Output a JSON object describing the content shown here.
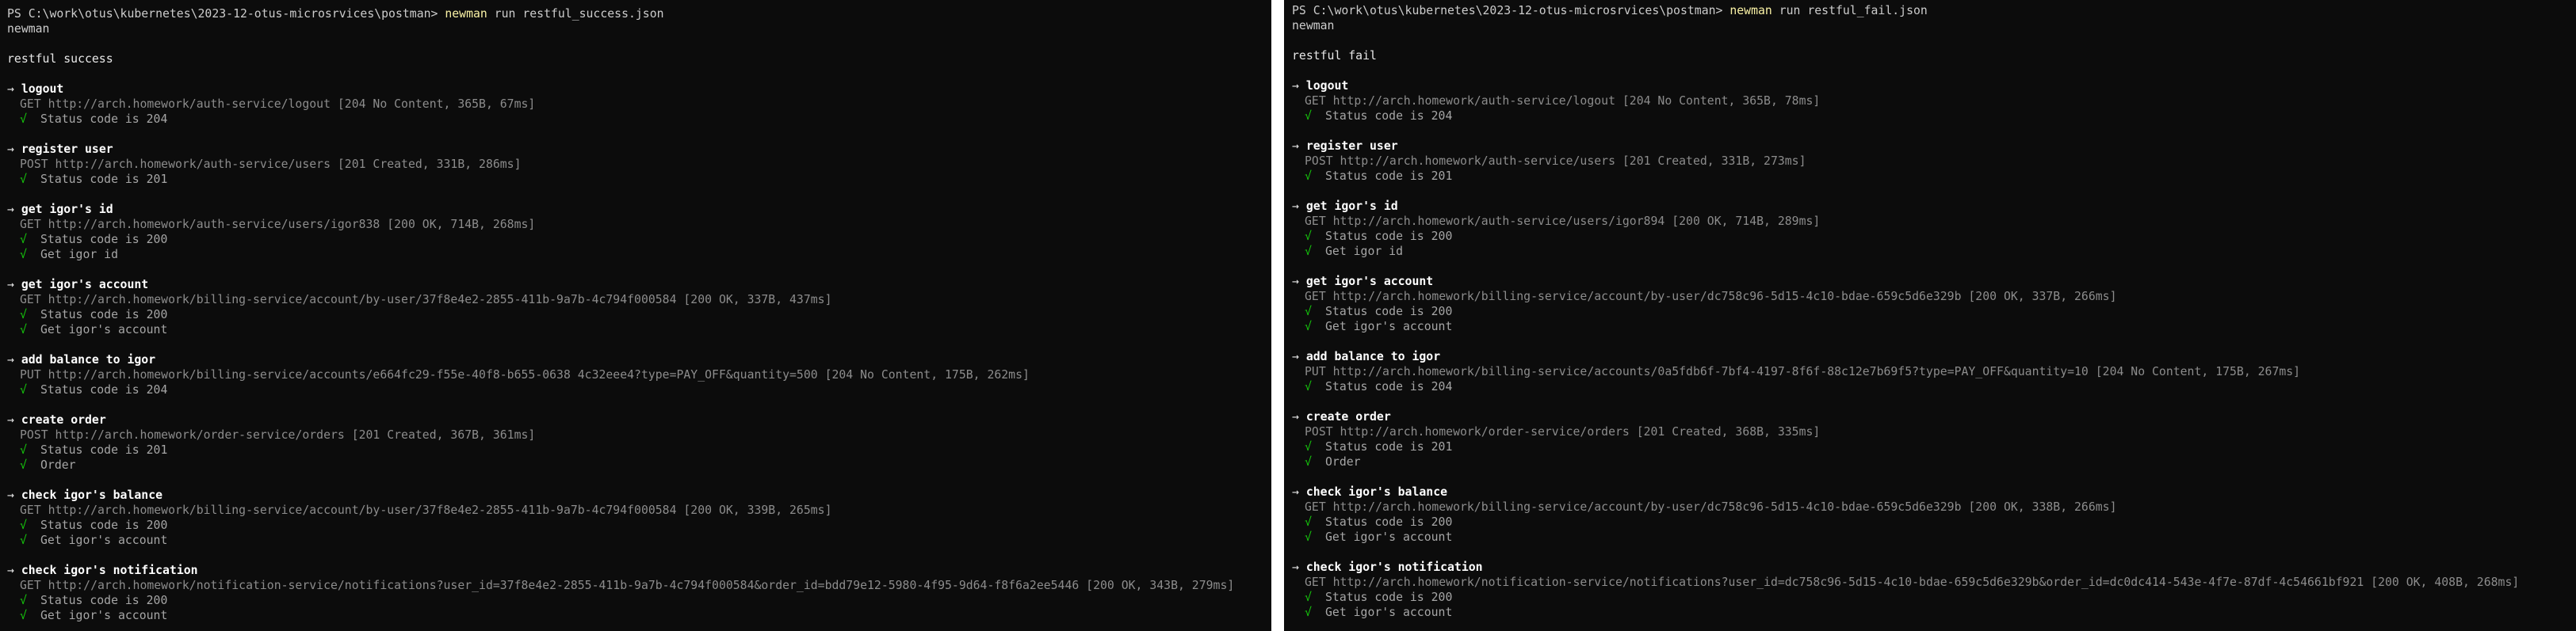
{
  "panes": [
    {
      "prompt": "PS C:\\work\\otus\\kubernetes\\2023-12-otus-microsrvices\\postman>",
      "command": "newman",
      "args": "run restful_success.json",
      "tool_line": "newman",
      "collection": "restful success",
      "requests": [
        {
          "name": "logout",
          "request": "GET http://arch.homework/auth-service/logout [204 No Content, 365B, 67ms]",
          "assertions": [
            "Status code is 204"
          ]
        },
        {
          "name": "register user",
          "request": "POST http://arch.homework/auth-service/users [201 Created, 331B, 286ms]",
          "assertions": [
            "Status code is 201"
          ]
        },
        {
          "name": "get igor's id",
          "request": "GET http://arch.homework/auth-service/users/igor838 [200 OK, 714B, 268ms]",
          "assertions": [
            "Status code is 200",
            "Get igor id"
          ]
        },
        {
          "name": "get igor's account",
          "request": "GET http://arch.homework/billing-service/account/by-user/37f8e4e2-2855-411b-9a7b-4c794f000584 [200 OK, 337B, 437ms]",
          "assertions": [
            "Status code is 200",
            "Get igor's account"
          ]
        },
        {
          "name": "add balance to igor",
          "request": "PUT http://arch.homework/billing-service/accounts/e664fc29-f55e-40f8-b655-0638 4c32eee4?type=PAY_OFF&quantity=500 [204 No Content, 175B, 262ms]",
          "assertions": [
            "Status code is 204"
          ]
        },
        {
          "name": "create order",
          "request": "POST http://arch.homework/order-service/orders [201 Created, 367B, 361ms]",
          "assertions": [
            "Status code is 201",
            "Order"
          ]
        },
        {
          "name": "check igor's balance",
          "request": "GET http://arch.homework/billing-service/account/by-user/37f8e4e2-2855-411b-9a7b-4c794f000584 [200 OK, 339B, 265ms]",
          "assertions": [
            "Status code is 200",
            "Get igor's account"
          ]
        },
        {
          "name": "check igor's notification",
          "request": "GET http://arch.homework/notification-service/notifications?user_id=37f8e4e2-2855-411b-9a7b-4c794f000584&order_id=bdd79e12-5980-4f95-9d64-f8f6a2ee5446 [200 OK, 343B, 279ms]",
          "assertions": [
            "Status code is 200",
            "Get igor's account"
          ]
        }
      ]
    },
    {
      "prompt": "PS C:\\work\\otus\\kubernetes\\2023-12-otus-microsrvices\\postman>",
      "command": "newman",
      "args": "run restful_fail.json",
      "tool_line": "newman",
      "collection": "restful fail",
      "requests": [
        {
          "name": "logout",
          "request": "GET http://arch.homework/auth-service/logout [204 No Content, 365B, 78ms]",
          "assertions": [
            "Status code is 204"
          ]
        },
        {
          "name": "register user",
          "request": "POST http://arch.homework/auth-service/users [201 Created, 331B, 273ms]",
          "assertions": [
            "Status code is 201"
          ]
        },
        {
          "name": "get igor's id",
          "request": "GET http://arch.homework/auth-service/users/igor894 [200 OK, 714B, 289ms]",
          "assertions": [
            "Status code is 200",
            "Get igor id"
          ]
        },
        {
          "name": "get igor's account",
          "request": "GET http://arch.homework/billing-service/account/by-user/dc758c96-5d15-4c10-bdae-659c5d6e329b [200 OK, 337B, 266ms]",
          "assertions": [
            "Status code is 200",
            "Get igor's account"
          ]
        },
        {
          "name": "add balance to igor",
          "request": "PUT http://arch.homework/billing-service/accounts/0a5fdb6f-7bf4-4197-8f6f-88c12e7b69f5?type=PAY_OFF&quantity=10 [204 No Content, 175B, 267ms]",
          "assertions": [
            "Status code is 204"
          ]
        },
        {
          "name": "create order",
          "request": "POST http://arch.homework/order-service/orders [201 Created, 368B, 335ms]",
          "assertions": [
            "Status code is 201",
            "Order"
          ]
        },
        {
          "name": "check igor's balance",
          "request": "GET http://arch.homework/billing-service/account/by-user/dc758c96-5d15-4c10-bdae-659c5d6e329b [200 OK, 338B, 266ms]",
          "assertions": [
            "Status code is 200",
            "Get igor's account"
          ]
        },
        {
          "name": "check igor's notification",
          "request": "GET http://arch.homework/notification-service/notifications?user_id=dc758c96-5d15-4c10-bdae-659c5d6e329b&order_id=dc0dc414-543e-4f7e-87df-4c54661bf921 [200 OK, 408B, 268ms]",
          "assertions": [
            "Status code is 200",
            "Get igor's account"
          ]
        }
      ]
    }
  ],
  "icons": {
    "arrow": "→",
    "check": "√"
  },
  "colors": {
    "terminal_bg": "#0c0c0c",
    "command": "#f9f1a5",
    "check": "#16c60c",
    "request_text": "#8c8c8c"
  }
}
